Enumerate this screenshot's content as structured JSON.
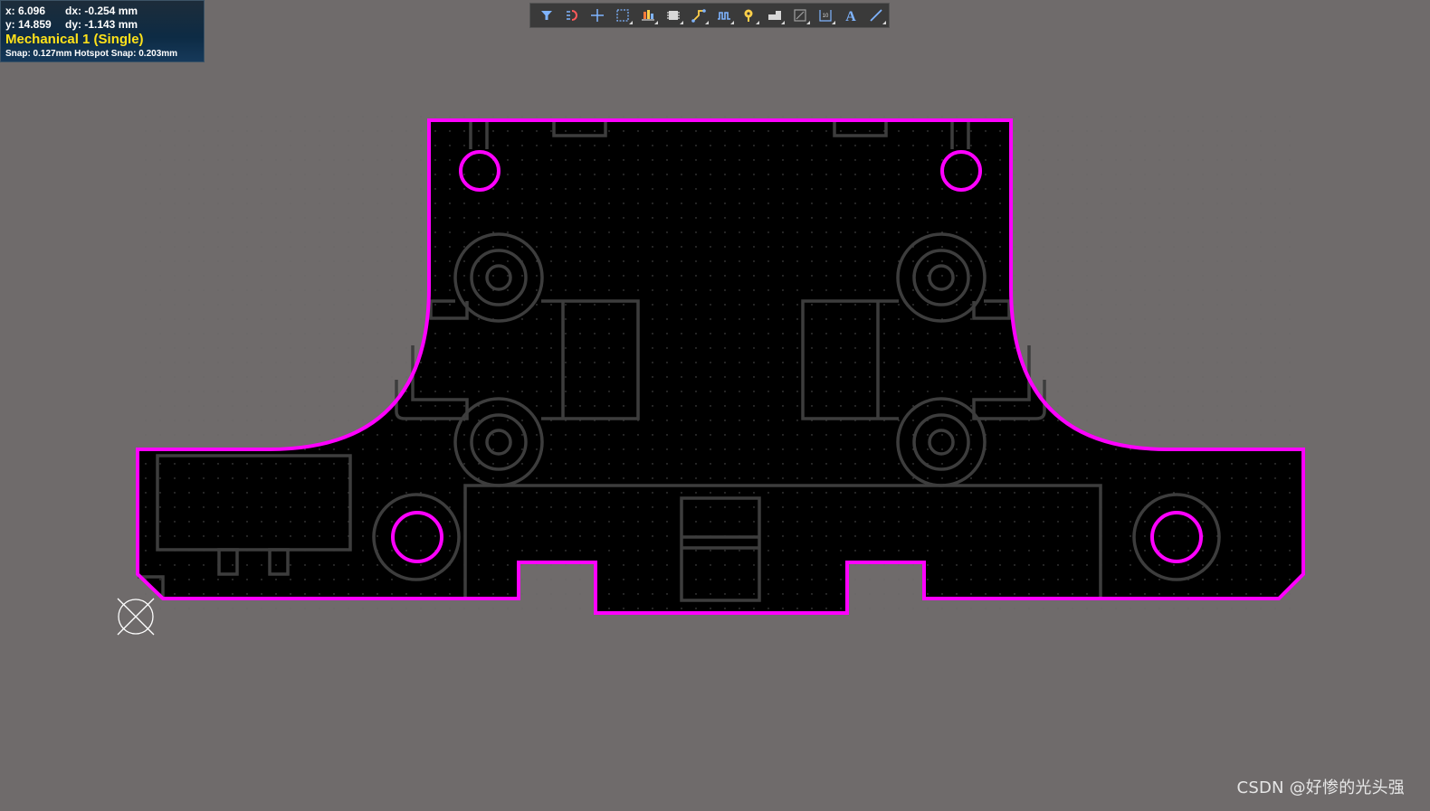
{
  "hud": {
    "x_readout": "x:  6.096",
    "dx_readout": "dx: -0.254 mm",
    "y_readout": "y: 14.859",
    "dy_readout": "dy: -1.143  mm",
    "layer": "Mechanical 1 (Single)",
    "snap": "Snap: 0.127mm Hotspot Snap: 0.203mm"
  },
  "toolbar": {
    "buttons": [
      {
        "icon": "filter-icon"
      },
      {
        "icon": "route-icon"
      },
      {
        "icon": "crosshair-icon"
      },
      {
        "icon": "select-rect-icon"
      },
      {
        "icon": "align-icon"
      },
      {
        "icon": "component-icon"
      },
      {
        "icon": "interactive-route-icon"
      },
      {
        "icon": "length-tune-icon"
      },
      {
        "icon": "via-icon"
      },
      {
        "icon": "fill-icon"
      },
      {
        "icon": "polygon-icon"
      },
      {
        "icon": "dimension-icon"
      },
      {
        "icon": "text-icon"
      },
      {
        "icon": "line-icon"
      }
    ],
    "text_button_label": "A"
  },
  "colors": {
    "background": "#6f6b6b",
    "board": "#000000",
    "outline": "#ff00ff",
    "mechanical": "#3b3b3b",
    "grid_dot": "#5a5a5a"
  },
  "watermark": "CSDN @好惨的光头强"
}
